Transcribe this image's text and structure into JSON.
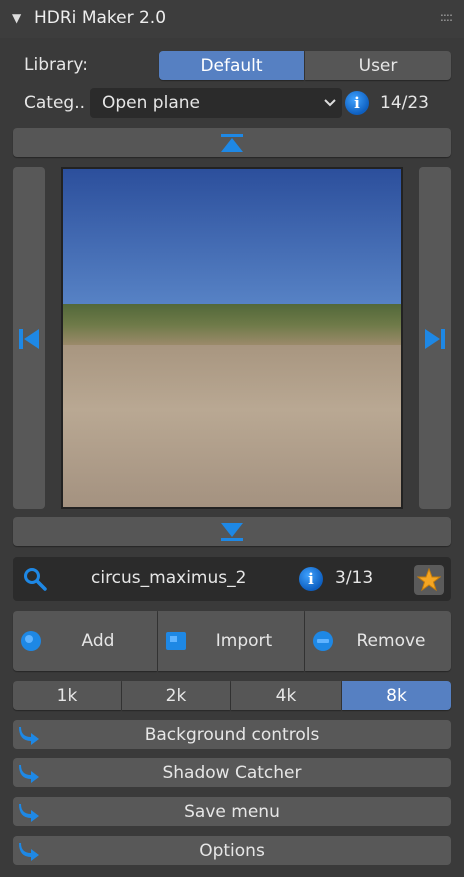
{
  "panel": {
    "title": "HDRi Maker 2.0"
  },
  "library": {
    "label": "Library:",
    "options": [
      "Default",
      "User"
    ],
    "active": "Default"
  },
  "category": {
    "label": "Categ..",
    "selected": "Open plane",
    "counter": "14/23"
  },
  "hdri": {
    "name": "circus_maximus_2",
    "counter": "3/13"
  },
  "actions": {
    "add": "Add",
    "import": "Import",
    "remove": "Remove"
  },
  "resolutions": [
    "1k",
    "2k",
    "4k",
    "8k"
  ],
  "resolution_active": "8k",
  "menus": {
    "background": "Background controls",
    "shadow": "Shadow Catcher",
    "save": "Save menu",
    "options": "Options"
  },
  "colors": {
    "accent": "#5680c2",
    "icon_blue": "#1e88e5",
    "panel_bg": "#3a3a3a",
    "button_bg": "#585858"
  }
}
